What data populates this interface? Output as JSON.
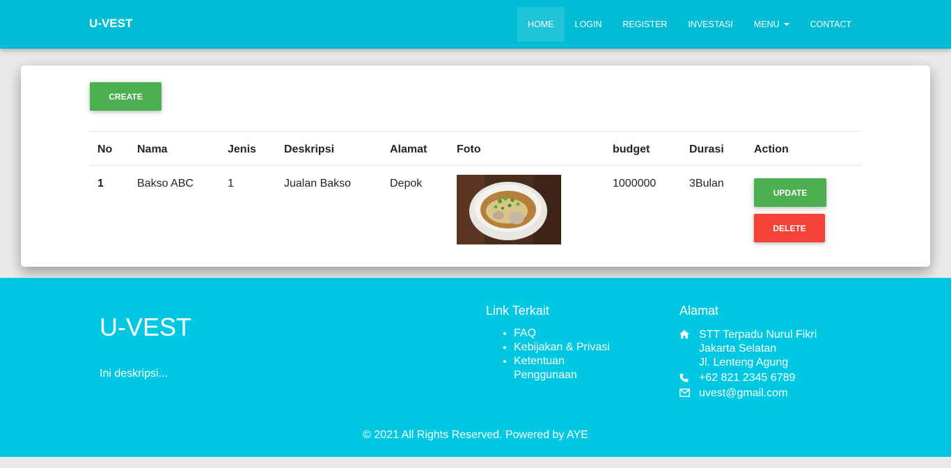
{
  "navbar": {
    "brand": "U-VEST",
    "items": [
      {
        "label": "HOME"
      },
      {
        "label": "LOGIN"
      },
      {
        "label": "REGISTER"
      },
      {
        "label": "INVESTASI"
      },
      {
        "label": "MENU"
      },
      {
        "label": "CONTACT"
      }
    ]
  },
  "main": {
    "create_label": "CREATE",
    "table": {
      "headers": [
        "No",
        "Nama",
        "Jenis",
        "Deskripsi",
        "Alamat",
        "Foto",
        "budget",
        "Durasi",
        "Action"
      ],
      "rows": [
        {
          "no": "1",
          "nama": "Bakso ABC",
          "jenis": "1",
          "deskripsi": "Jualan Bakso",
          "alamat": "Depok",
          "foto": "bakso-photo",
          "budget": "1000000",
          "durasi": "3Bulan",
          "update_label": "UPDATE",
          "delete_label": "DELETE"
        }
      ]
    }
  },
  "footer": {
    "brand": "U-VEST",
    "description": "Ini deskripsi...",
    "links_title": "Link Terkait",
    "links": [
      "FAQ",
      "Kebijakan & Privasi",
      "Ketentuan Penggunaan"
    ],
    "address_title": "Alamat",
    "address_line1": "STT Terpadu Nurul Fikri",
    "address_line2": "Jakarta Selatan",
    "address_line3": "Jl. Lenteng Agung",
    "phone": "+62 821 2345 6789",
    "email": "uvest@gmail.com",
    "copyright": "© 2021 All Rights Reserved. Powered by AYE"
  },
  "colors": {
    "primary": "#00bcd4",
    "footer": "#00c8e3",
    "success": "#4caf50",
    "danger": "#f44336"
  }
}
